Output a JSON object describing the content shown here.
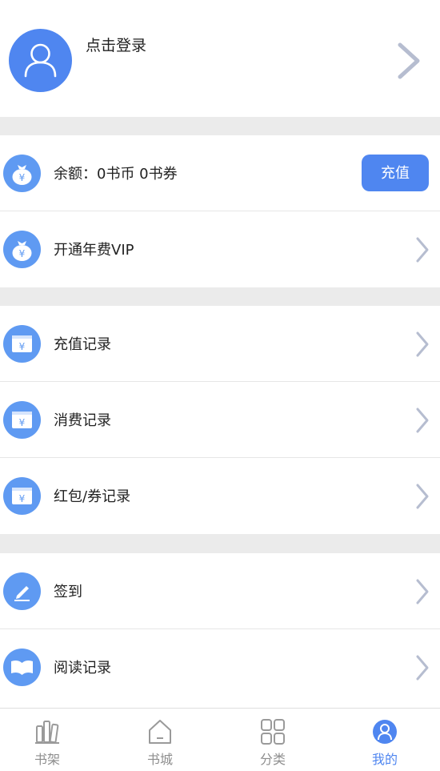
{
  "profile": {
    "login_label": "点击登录"
  },
  "balance": {
    "label": "余额：0书币  0书券",
    "button_label": "充值"
  },
  "vip": {
    "label": "开通年费VIP"
  },
  "records": {
    "recharge": "充值记录",
    "consume": "消费记录",
    "coupon": "红包/券记录"
  },
  "actions": {
    "checkin": "签到",
    "reading": "阅读记录"
  },
  "tabbar": {
    "items": [
      {
        "label": "书架",
        "icon": "bookshelf-icon"
      },
      {
        "label": "书城",
        "icon": "home-icon"
      },
      {
        "label": "分类",
        "icon": "category-icon"
      },
      {
        "label": "我的",
        "icon": "profile-icon",
        "active": true
      }
    ]
  },
  "colors": {
    "accent": "#4f86f0",
    "icon_bg": "#5f9af2",
    "gap": "#ebebeb",
    "chevron": "#b6bdd0"
  }
}
